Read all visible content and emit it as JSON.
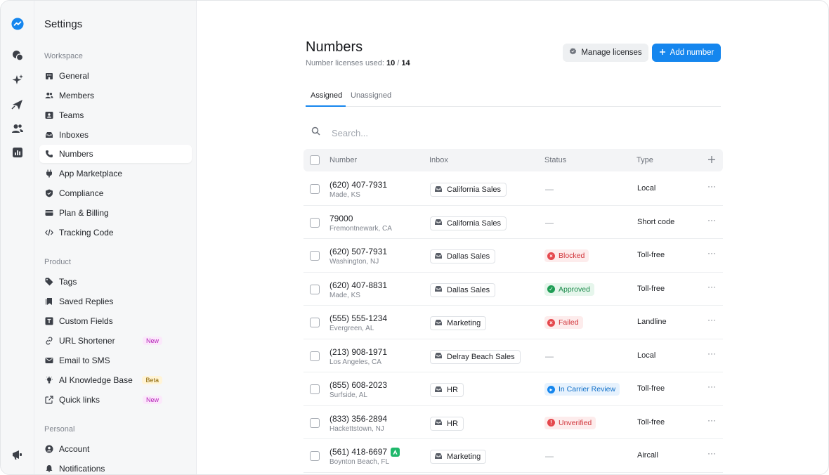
{
  "sidebar": {
    "title": "Settings",
    "groups": {
      "workspace": "Workspace",
      "product": "Product",
      "personal": "Personal"
    },
    "items": [
      {
        "label": "General"
      },
      {
        "label": "Members"
      },
      {
        "label": "Teams"
      },
      {
        "label": "Inboxes"
      },
      {
        "label": "Numbers"
      },
      {
        "label": "App Marketplace"
      },
      {
        "label": "Compliance"
      },
      {
        "label": "Plan & Billing"
      },
      {
        "label": "Tracking Code"
      },
      {
        "label": "Tags"
      },
      {
        "label": "Saved Replies"
      },
      {
        "label": "Custom Fields"
      },
      {
        "label": "URL Shortener",
        "badge": "New"
      },
      {
        "label": "Email to SMS"
      },
      {
        "label": "AI Knowledge Base",
        "badge": "Beta"
      },
      {
        "label": "Quick links",
        "badge": "New"
      },
      {
        "label": "Account"
      },
      {
        "label": "Notifications"
      }
    ]
  },
  "page": {
    "title": "Numbers",
    "licenses_label": "Number licenses used:",
    "licenses_used": "10",
    "licenses_sep": "/",
    "licenses_total": "14",
    "manage_label": "Manage licenses",
    "add_label": "Add number"
  },
  "tabs": [
    {
      "label": "Assigned"
    },
    {
      "label": "Unassigned"
    }
  ],
  "search": {
    "placeholder": "Search..."
  },
  "table": {
    "headers": {
      "number": "Number",
      "inbox": "Inbox",
      "status": "Status",
      "type": "Type"
    },
    "rows": [
      {
        "number": "(620) 407-7931",
        "location": "Made, KS",
        "inbox": "California Sales",
        "status": "—",
        "type": "Local"
      },
      {
        "number": "79000",
        "location": "Fremontnewark, CA",
        "inbox": "California Sales",
        "status": "—",
        "type": "Short code"
      },
      {
        "number": "(620) 507-7931",
        "location": "Washington, NJ",
        "inbox": "Dallas Sales",
        "status": "Blocked",
        "type": "Toll-free"
      },
      {
        "number": "(620) 407-8831",
        "location": "Made, KS",
        "inbox": "Dallas Sales",
        "status": "Approved",
        "type": "Toll-free"
      },
      {
        "number": "(555) 555-1234",
        "location": "Evergreen, AL",
        "inbox": "Marketing",
        "status": "Failed",
        "type": "Landline"
      },
      {
        "number": "(213) 908-1971",
        "location": "Los Angeles, CA",
        "inbox": "Delray Beach Sales",
        "status": "—",
        "type": "Local"
      },
      {
        "number": "(855) 608-2023",
        "location": "Surfside, AL",
        "inbox": "HR",
        "status": "In Carrier Review",
        "type": "Toll-free"
      },
      {
        "number": "(833) 356-2894",
        "location": "Hackettstown, NJ",
        "inbox": "HR",
        "status": "Unverified",
        "type": "Toll-free"
      },
      {
        "number": "(561) 418-6697",
        "location": "Boynton Beach, FL",
        "inbox": "Marketing",
        "status": "—",
        "type": "Aircall"
      }
    ],
    "more": "···"
  },
  "colors": {
    "accent": "#1586ee",
    "blocked": "#e5484d",
    "approved": "#1f9d55",
    "failed": "#e5484d",
    "review": "#1586ee",
    "unverified": "#e5484d"
  }
}
